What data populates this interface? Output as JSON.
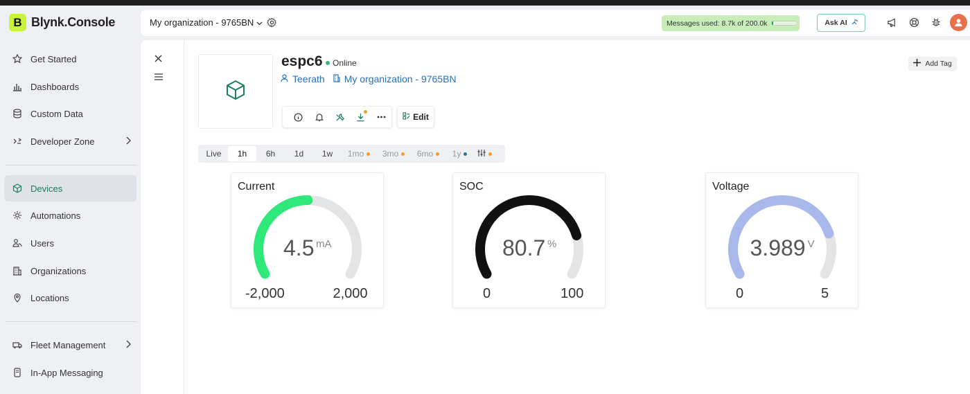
{
  "app": {
    "logo_letter": "B",
    "logo_text": "Blynk.Console"
  },
  "sidebar": {
    "items": [
      {
        "label": "Get Started",
        "icon": "star-icon"
      },
      {
        "label": "Dashboards",
        "icon": "bar-chart-icon"
      },
      {
        "label": "Custom Data",
        "icon": "database-icon"
      },
      {
        "label": "Developer Zone",
        "icon": "developer-icon"
      },
      {
        "label": "Devices",
        "icon": "cube-icon",
        "active": true
      },
      {
        "label": "Automations",
        "icon": "automation-icon"
      },
      {
        "label": "Users",
        "icon": "users-icon"
      },
      {
        "label": "Organizations",
        "icon": "building-icon"
      },
      {
        "label": "Locations",
        "icon": "location-pin-icon"
      },
      {
        "label": "Fleet Management",
        "icon": "truck-icon"
      },
      {
        "label": "In-App Messaging",
        "icon": "message-icon"
      }
    ]
  },
  "header": {
    "org_name": "My organization - 9765BN",
    "messages_label": "Messages used:",
    "messages_value": "8.7k of 200.0k",
    "messages_progress": 0.0435,
    "ask_ai": "Ask AI"
  },
  "device": {
    "name": "espc6",
    "status": "Online",
    "owner": "Teerath",
    "organization": "My organization - 9765BN",
    "add_tag": "Add Tag",
    "edit": "Edit"
  },
  "time_ranges": [
    {
      "label": "Live",
      "state": "normal"
    },
    {
      "label": "1h",
      "state": "active"
    },
    {
      "label": "6h",
      "state": "normal"
    },
    {
      "label": "1d",
      "state": "normal"
    },
    {
      "label": "1w",
      "state": "normal"
    },
    {
      "label": "1mo",
      "state": "disabled",
      "dot": "#f0a020"
    },
    {
      "label": "3mo",
      "state": "disabled",
      "dot": "#f0a020"
    },
    {
      "label": "6mo",
      "state": "disabled",
      "dot": "#f0a020"
    },
    {
      "label": "1y",
      "state": "disabled",
      "dot": "#2a72b8"
    }
  ],
  "gauges": [
    {
      "title": "Current",
      "value": "4.5",
      "value_num": 4.5,
      "unit": "mA",
      "min": "-2,000",
      "max": "2,000",
      "min_num": -2000,
      "max_num": 2000,
      "color": "#2ee87a"
    },
    {
      "title": "SOC",
      "value": "80.7",
      "value_num": 80.7,
      "unit": "%",
      "min": "0",
      "max": "100",
      "min_num": 0,
      "max_num": 100,
      "color": "#111111"
    },
    {
      "title": "Voltage",
      "value": "3.989",
      "value_num": 3.989,
      "unit": "V",
      "min": "0",
      "max": "5",
      "min_num": 0,
      "max_num": 5,
      "color": "#a9b8ea"
    }
  ]
}
